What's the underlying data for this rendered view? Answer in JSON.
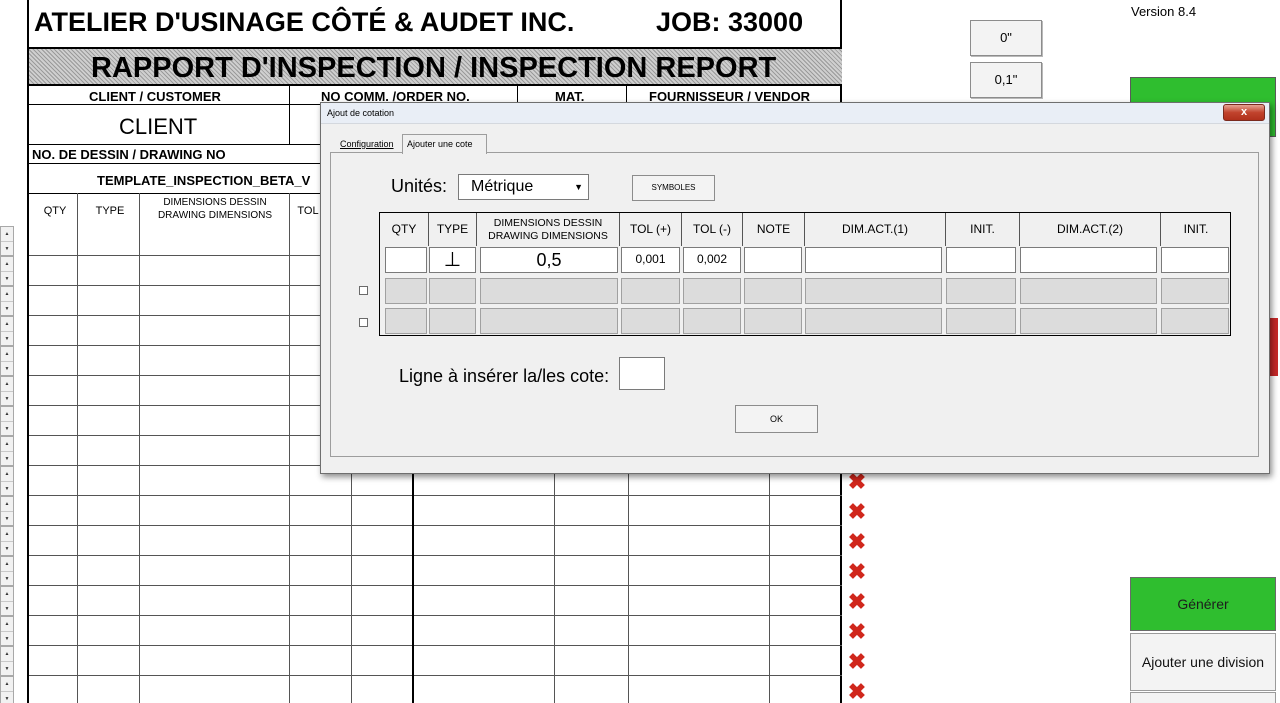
{
  "sheet": {
    "company": "ATELIER D'USINAGE CÔTÉ & AUDET INC.",
    "job": "JOB: 33000",
    "report_title": "RAPPORT D'INSPECTION / INSPECTION REPORT",
    "client_label": "CLIENT / CUSTOMER",
    "order_label": "NO COMM. /ORDER NO.",
    "mat_label": "MAT.",
    "vendor_label": "FOURNISSEUR / VENDOR",
    "client_value": "CLIENT",
    "drawing_label": "NO. DE DESSIN / DRAWING NO",
    "template_value": "TEMPLATE_INSPECTION_BETA_V",
    "col_qty": "QTY",
    "col_type": "TYPE",
    "col_dim": "DIMENSIONS DESSIN DRAWING DIMENSIONS",
    "col_tol": "TOL"
  },
  "right_panel": {
    "version": "Version 8.4",
    "inc_0": "0\"",
    "inc_1": "0,1\"",
    "generate": "Générer",
    "add_division": "Ajouter une division"
  },
  "dialog": {
    "title": "Ajout de cotation",
    "close": "x",
    "tab_config": "Configuration",
    "tab_add": "Ajouter une cote",
    "units_label": "Unités:",
    "units_value": "Métrique",
    "symbols_btn": "SYMBOLES",
    "headers": [
      "QTY",
      "TYPE",
      "DIMENSIONS DESSIN DRAWING DIMENSIONS",
      "TOL (+)",
      "TOL (-)",
      "NOTE",
      "DIM.ACT.(1)",
      "INIT.",
      "DIM.ACT.(2)",
      "INIT."
    ],
    "row1": {
      "qty": "",
      "type": "⊥",
      "dim": "0,5",
      "tol_plus": "0,001",
      "tol_minus": "0,002"
    },
    "line_label": "Ligne à insérer la/les cote:",
    "ok": "OK"
  }
}
